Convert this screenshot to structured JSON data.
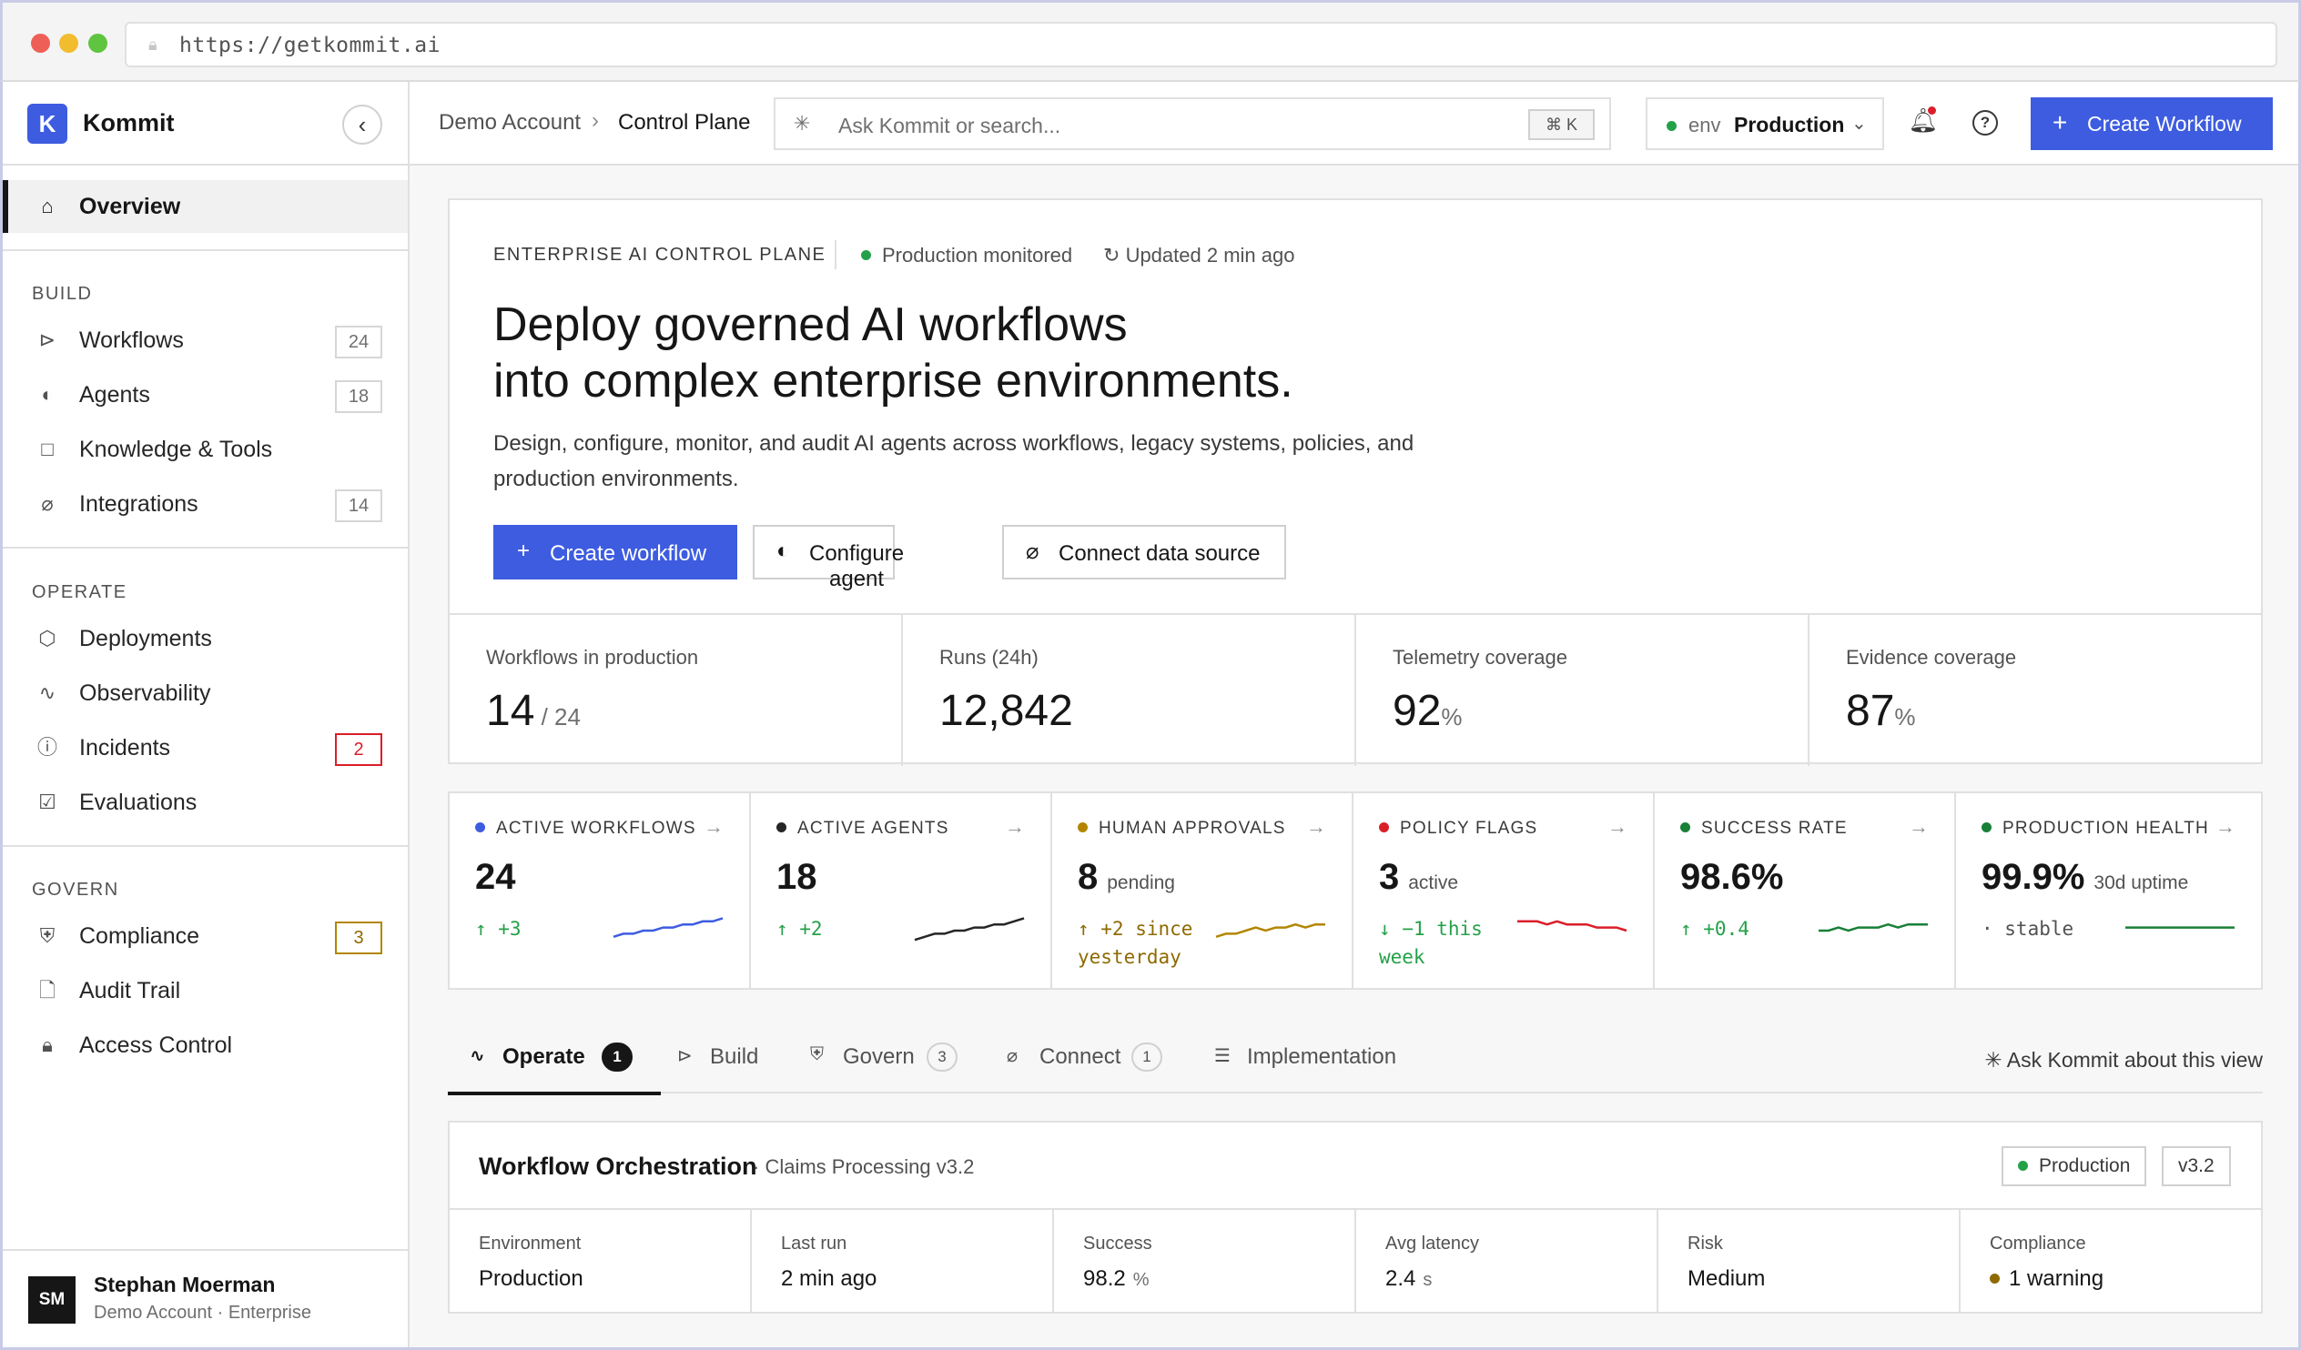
{
  "browser": {
    "url": "https://getkommit.ai"
  },
  "brand": {
    "name": "Kommit",
    "logo_letter": "K"
  },
  "sidebar": {
    "overview": "Overview",
    "sections": [
      {
        "title": "BUILD",
        "items": [
          {
            "label": "Workflows",
            "icon": "workflow-icon",
            "count": "24"
          },
          {
            "label": "Agents",
            "icon": "agent-icon",
            "count": "18"
          },
          {
            "label": "Knowledge & Tools",
            "icon": "book-icon",
            "count": null
          },
          {
            "label": "Integrations",
            "icon": "plug-icon",
            "count": "14"
          }
        ]
      },
      {
        "title": "OPERATE",
        "items": [
          {
            "label": "Deployments",
            "icon": "box-icon",
            "count": null
          },
          {
            "label": "Observability",
            "icon": "pulse-icon",
            "count": null
          },
          {
            "label": "Incidents",
            "icon": "alert-icon",
            "count": "2"
          },
          {
            "label": "Evaluations",
            "icon": "checkbox-icon",
            "count": null
          }
        ]
      },
      {
        "title": "GOVERN",
        "items": [
          {
            "label": "Compliance",
            "icon": "shield-icon",
            "count": "3"
          },
          {
            "label": "Audit Trail",
            "icon": "document-icon",
            "count": null
          },
          {
            "label": "Access Control",
            "icon": "lock-icon",
            "count": null
          }
        ]
      }
    ],
    "user": {
      "initials": "SM",
      "name": "Stephan Moerman",
      "subtitle": "Demo Account · Enterprise"
    }
  },
  "topbar": {
    "breadcrumb": [
      "Demo Account",
      "Control Plane"
    ],
    "search_placeholder": "Ask Kommit or search...",
    "shortcut": "⌘ K",
    "env_key": "env",
    "env_value": "Production",
    "create_button": "Create Workflow"
  },
  "hero": {
    "eyebrow": "ENTERPRISE AI CONTROL PLANE",
    "status": "Production monitored",
    "updated": "Updated 2 min ago",
    "headline_line1": "Deploy governed AI workflows",
    "headline_line2": "into complex enterprise environments.",
    "description": "Design, configure, monitor, and audit AI agents across workflows, legacy systems, policies, and production environments.",
    "buttons": {
      "create": "Create workflow",
      "configure": "Configure agent",
      "connect": "Connect data source"
    },
    "kpis": [
      {
        "label": "Workflows in production",
        "value": "14",
        "unit": " / 24"
      },
      {
        "label": "Runs (24h)",
        "value": "12,842",
        "unit": ""
      },
      {
        "label": "Telemetry coverage",
        "value": "92",
        "unit": "%"
      },
      {
        "label": "Evidence coverage",
        "value": "87",
        "unit": "%"
      }
    ]
  },
  "metrics": [
    {
      "label": "ACTIVE WORKFLOWS",
      "value": "24",
      "suffix": "",
      "delta": "↑ +3",
      "color": "#3d5ce0",
      "delta_color": "#24a148",
      "trend": [
        3,
        4,
        4,
        5,
        5,
        6,
        6,
        7,
        7,
        8,
        8,
        9
      ]
    },
    {
      "label": "ACTIVE AGENTS",
      "value": "18",
      "suffix": "",
      "delta": "↑ +2",
      "color": "#262626",
      "delta_color": "#24a148",
      "trend": [
        2,
        3,
        4,
        4,
        5,
        5,
        6,
        6,
        7,
        7,
        8,
        9
      ]
    },
    {
      "label": "HUMAN APPROVALS",
      "value": "8",
      "suffix": "pending",
      "delta": "↑ +2 since yesterday",
      "color": "#b28600",
      "delta_color": "#8e6a00",
      "trend": [
        3,
        4,
        4,
        5,
        6,
        5,
        6,
        6,
        7,
        6,
        7,
        7
      ]
    },
    {
      "label": "POLICY FLAGS",
      "value": "3",
      "suffix": "active",
      "delta": "↓ −1 this week",
      "color": "#da1e28",
      "delta_color": "#24a148",
      "trend": [
        8,
        8,
        8,
        7,
        8,
        7,
        7,
        7,
        6,
        6,
        6,
        5
      ]
    },
    {
      "label": "SUCCESS RATE",
      "value": "98.6%",
      "suffix": "",
      "delta": "↑ +0.4",
      "color": "#198038",
      "delta_color": "#24a148",
      "trend": [
        5,
        5,
        6,
        5,
        6,
        6,
        6,
        7,
        6,
        7,
        7,
        7
      ]
    },
    {
      "label": "PRODUCTION HEALTH",
      "value": "99.9%",
      "suffix": "30d uptime",
      "delta": "· stable",
      "color": "#198038",
      "delta_color": "#525252",
      "trend": [
        6,
        6,
        6,
        6,
        6,
        6,
        6,
        6,
        6,
        6,
        6,
        6
      ]
    }
  ],
  "tabs": [
    {
      "label": "Operate",
      "badge": "1",
      "icon": "pulse-icon",
      "active": true
    },
    {
      "label": "Build",
      "badge": null,
      "icon": "workflow-icon",
      "active": false
    },
    {
      "label": "Govern",
      "badge": "3",
      "icon": "shield-icon",
      "active": false
    },
    {
      "label": "Connect",
      "badge": "1",
      "icon": "plug-icon",
      "active": false
    },
    {
      "label": "Implementation",
      "badge": null,
      "icon": "list-icon",
      "active": false
    }
  ],
  "ask_view": "Ask Kommit about this view",
  "workflow": {
    "title": "Workflow Orchestration",
    "subtitle": "· Claims Processing v3.2",
    "env_tag": "Production",
    "version_tag": "v3.2",
    "cells": [
      {
        "label": "Environment",
        "value": "Production",
        "unit": ""
      },
      {
        "label": "Last run",
        "value": "2 min ago",
        "unit": ""
      },
      {
        "label": "Success",
        "value": "98.2",
        "unit": "%"
      },
      {
        "label": "Avg latency",
        "value": "2.4",
        "unit": "s"
      },
      {
        "label": "Risk",
        "value": "Medium",
        "unit": ""
      },
      {
        "label": "Compliance",
        "value": "1 warning",
        "unit": ""
      }
    ]
  },
  "colors": {
    "accent": "#3d5ce0",
    "green": "#24a148",
    "red": "#da1e28",
    "amber": "#8e6a00"
  }
}
